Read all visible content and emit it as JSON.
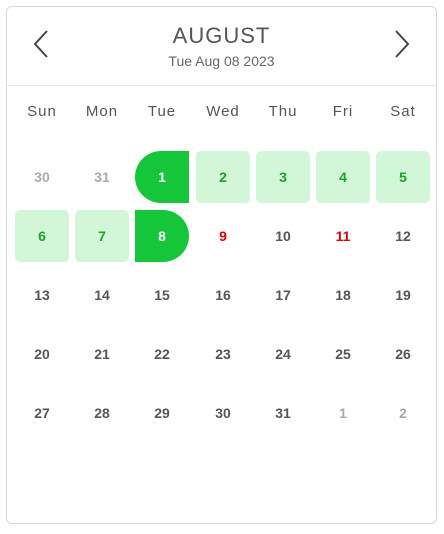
{
  "header": {
    "month": "AUGUST",
    "selected_date": "Tue Aug 08 2023",
    "prev_icon": "chevron-left-icon",
    "next_icon": "chevron-right-icon"
  },
  "weekdays": [
    "Sun",
    "Mon",
    "Tue",
    "Wed",
    "Thu",
    "Fri",
    "Sat"
  ],
  "weeks": [
    [
      {
        "label": "30",
        "state": "muted"
      },
      {
        "label": "31",
        "state": "muted"
      },
      {
        "label": "1",
        "state": "range-start"
      },
      {
        "label": "2",
        "state": "range"
      },
      {
        "label": "3",
        "state": "range"
      },
      {
        "label": "4",
        "state": "range"
      },
      {
        "label": "5",
        "state": "range"
      }
    ],
    [
      {
        "label": "6",
        "state": "range"
      },
      {
        "label": "7",
        "state": "range"
      },
      {
        "label": "8",
        "state": "range-end"
      },
      {
        "label": "9",
        "state": "holiday"
      },
      {
        "label": "10",
        "state": "normal"
      },
      {
        "label": "11",
        "state": "holiday"
      },
      {
        "label": "12",
        "state": "normal"
      }
    ],
    [
      {
        "label": "13",
        "state": "normal"
      },
      {
        "label": "14",
        "state": "normal"
      },
      {
        "label": "15",
        "state": "normal"
      },
      {
        "label": "16",
        "state": "normal"
      },
      {
        "label": "17",
        "state": "normal"
      },
      {
        "label": "18",
        "state": "normal"
      },
      {
        "label": "19",
        "state": "normal"
      }
    ],
    [
      {
        "label": "20",
        "state": "normal"
      },
      {
        "label": "21",
        "state": "normal"
      },
      {
        "label": "22",
        "state": "normal"
      },
      {
        "label": "23",
        "state": "normal"
      },
      {
        "label": "24",
        "state": "normal"
      },
      {
        "label": "25",
        "state": "normal"
      },
      {
        "label": "26",
        "state": "normal"
      }
    ],
    [
      {
        "label": "27",
        "state": "normal"
      },
      {
        "label": "28",
        "state": "normal"
      },
      {
        "label": "29",
        "state": "normal"
      },
      {
        "label": "30",
        "state": "normal"
      },
      {
        "label": "31",
        "state": "normal"
      },
      {
        "label": "1",
        "state": "muted"
      },
      {
        "label": "2",
        "state": "muted"
      }
    ]
  ],
  "colors": {
    "range_fill": "#d3f5d8",
    "range_text": "#1aa51f",
    "endpoint_fill": "#15c63a",
    "holiday_text": "#dd0000",
    "muted_text": "#aaaaaa"
  }
}
